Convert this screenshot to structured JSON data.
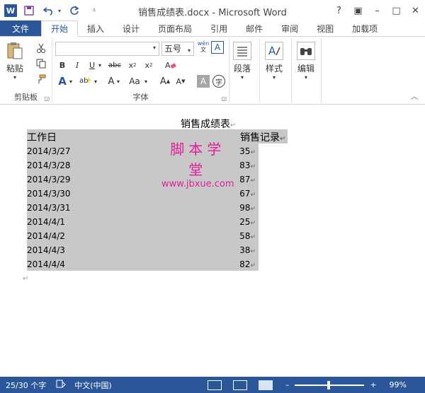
{
  "app": {
    "title": "销售成绩表.docx - Microsoft Word",
    "logo_letter": "W",
    "window_controls": [
      "?",
      "▣",
      "–",
      "□",
      "✕"
    ]
  },
  "tabs": {
    "file": "文件",
    "items": [
      "开始",
      "插入",
      "设计",
      "页面布局",
      "引用",
      "邮件",
      "审阅",
      "视图",
      "加载项"
    ],
    "active": "开始"
  },
  "ribbon": {
    "clipboard": {
      "paste": "粘贴",
      "group": "剪贴板"
    },
    "font": {
      "name_value": "",
      "size_value": "五号",
      "phonetic": "wén",
      "group": "字体"
    },
    "paragraph": {
      "label": "段落"
    },
    "styles": {
      "label": "样式"
    },
    "editing": {
      "label": "编辑"
    }
  },
  "document": {
    "title": "销售成绩表",
    "table": {
      "header": [
        "工作日",
        "销售记录"
      ],
      "rows": [
        [
          "2014/3/27",
          "35"
        ],
        [
          "2014/3/28",
          "83"
        ],
        [
          "2014/3/29",
          "87"
        ],
        [
          "2014/3/30",
          "67"
        ],
        [
          "2014/3/31",
          "98"
        ],
        [
          "2014/4/1",
          "25"
        ],
        [
          "2014/4/2",
          "58"
        ],
        [
          "2014/4/3",
          "38"
        ],
        [
          "2014/4/4",
          "82"
        ]
      ]
    },
    "watermark": {
      "line1": "脚本学堂",
      "line2": "www.jbxue.com"
    }
  },
  "status": {
    "words": "25/30 个字",
    "language": "中文(中国)",
    "zoom": "99%"
  },
  "colors": {
    "accent": "#2b579a",
    "selection": "#c8c8c8",
    "watermark": "#e0209a"
  }
}
